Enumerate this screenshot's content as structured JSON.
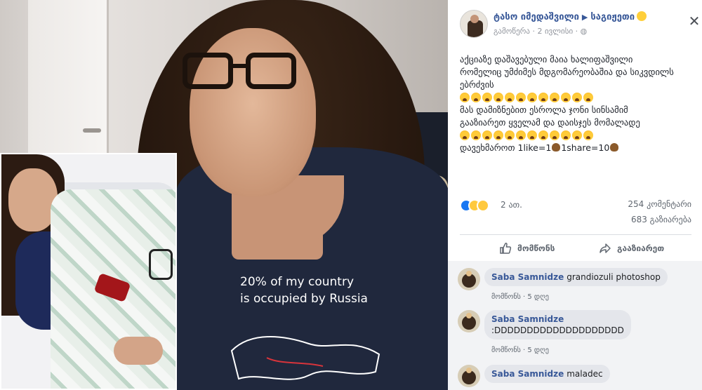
{
  "photo": {
    "shirt_line1": "20% of my country",
    "shirt_line2": "is occupied by Russia"
  },
  "post": {
    "author": "ტასო იმედაშვილი",
    "group": "საგიჟეთი",
    "meta": "გამოწერა · 2 ივლისი ·",
    "lines": [
      "აქციაზე დაშავებული მაია ხალიფაშვილი",
      "რომელიც უმძიმეს მდგომარეობაშია და სიკვდილს",
      "ებრძვის",
      "მას დამიზნებით ესროლა ჯონი სინსამიმ",
      "გააზიარეთ ყველამ და დაისჯეს მომალადე",
      "დავეხმაროთ 1like=1",
      "1share=10"
    ],
    "reactions_count": "2 ათ.",
    "comments_count": "254 კომენტარი",
    "shares_count": "683 გაზიარება",
    "like_label": "მომწონს",
    "share_label": "გააზიარეთ"
  },
  "comments": [
    {
      "name": "Saba Samnidze",
      "text": "grandiozuli photoshop",
      "like": "მომწონს",
      "time": "5 დღე"
    },
    {
      "name": "Saba Samnidze",
      "text": ":DDDDDDDDDDDDDDDDDDDD",
      "like": "მომწონს",
      "time": "5 დღე"
    },
    {
      "name": "Saba Samnidze",
      "text": "maladec"
    }
  ],
  "colors": {
    "link": "#385898",
    "muted": "#606770",
    "like_blue": "#1877f2"
  },
  "icons": {
    "more": "more-options-icon",
    "close": "close-icon",
    "like": "thumbs-up-icon",
    "share": "share-arrow-icon"
  }
}
